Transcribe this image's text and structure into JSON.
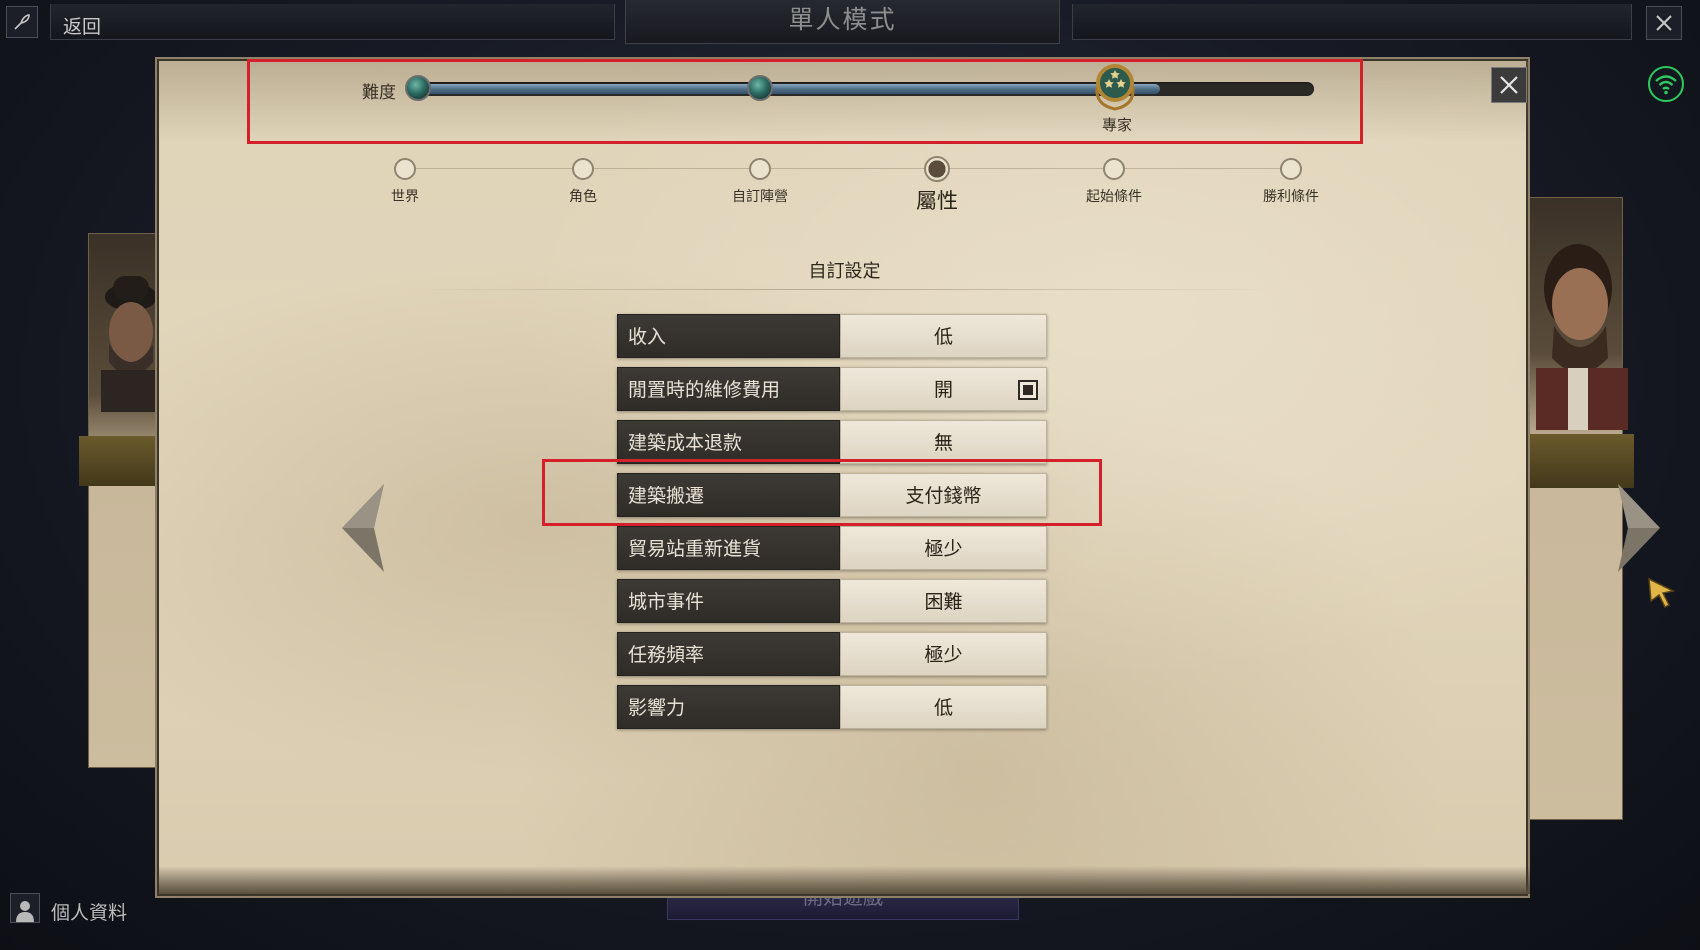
{
  "topbar": {
    "back_label": "返回",
    "title": "單人模式"
  },
  "difficulty": {
    "label": "難度",
    "value": "專家",
    "level_fraction": 0.83
  },
  "steps": [
    {
      "label": "世界",
      "active": false
    },
    {
      "label": "角色",
      "active": false
    },
    {
      "label": "自訂陣營",
      "active": false
    },
    {
      "label": "屬性",
      "active": true
    },
    {
      "label": "起始條件",
      "active": false
    },
    {
      "label": "勝利條件",
      "active": false
    }
  ],
  "section": {
    "title": "自訂設定"
  },
  "settings": [
    {
      "label": "收入",
      "value": "低",
      "checkbox": false
    },
    {
      "label": "閒置時的維修費用",
      "value": "開",
      "checkbox": true
    },
    {
      "label": "建築成本退款",
      "value": "無",
      "checkbox": false
    },
    {
      "label": "建築搬遷",
      "value": "支付錢幣",
      "checkbox": false
    },
    {
      "label": "貿易站重新進貨",
      "value": "極少",
      "checkbox": false
    },
    {
      "label": "城市事件",
      "value": "困難",
      "checkbox": false
    },
    {
      "label": "任務頻率",
      "value": "極少",
      "checkbox": false
    },
    {
      "label": "影響力",
      "value": "低",
      "checkbox": false
    }
  ],
  "bottom": {
    "profile_label": "個人資料",
    "start_game_label": "開始遊戲"
  },
  "colors": {
    "highlight_box": "#d3202a",
    "parchment": "#e2d6bc",
    "setting_label_bg": "#34312d",
    "wifi_green": "#2ec95c"
  }
}
